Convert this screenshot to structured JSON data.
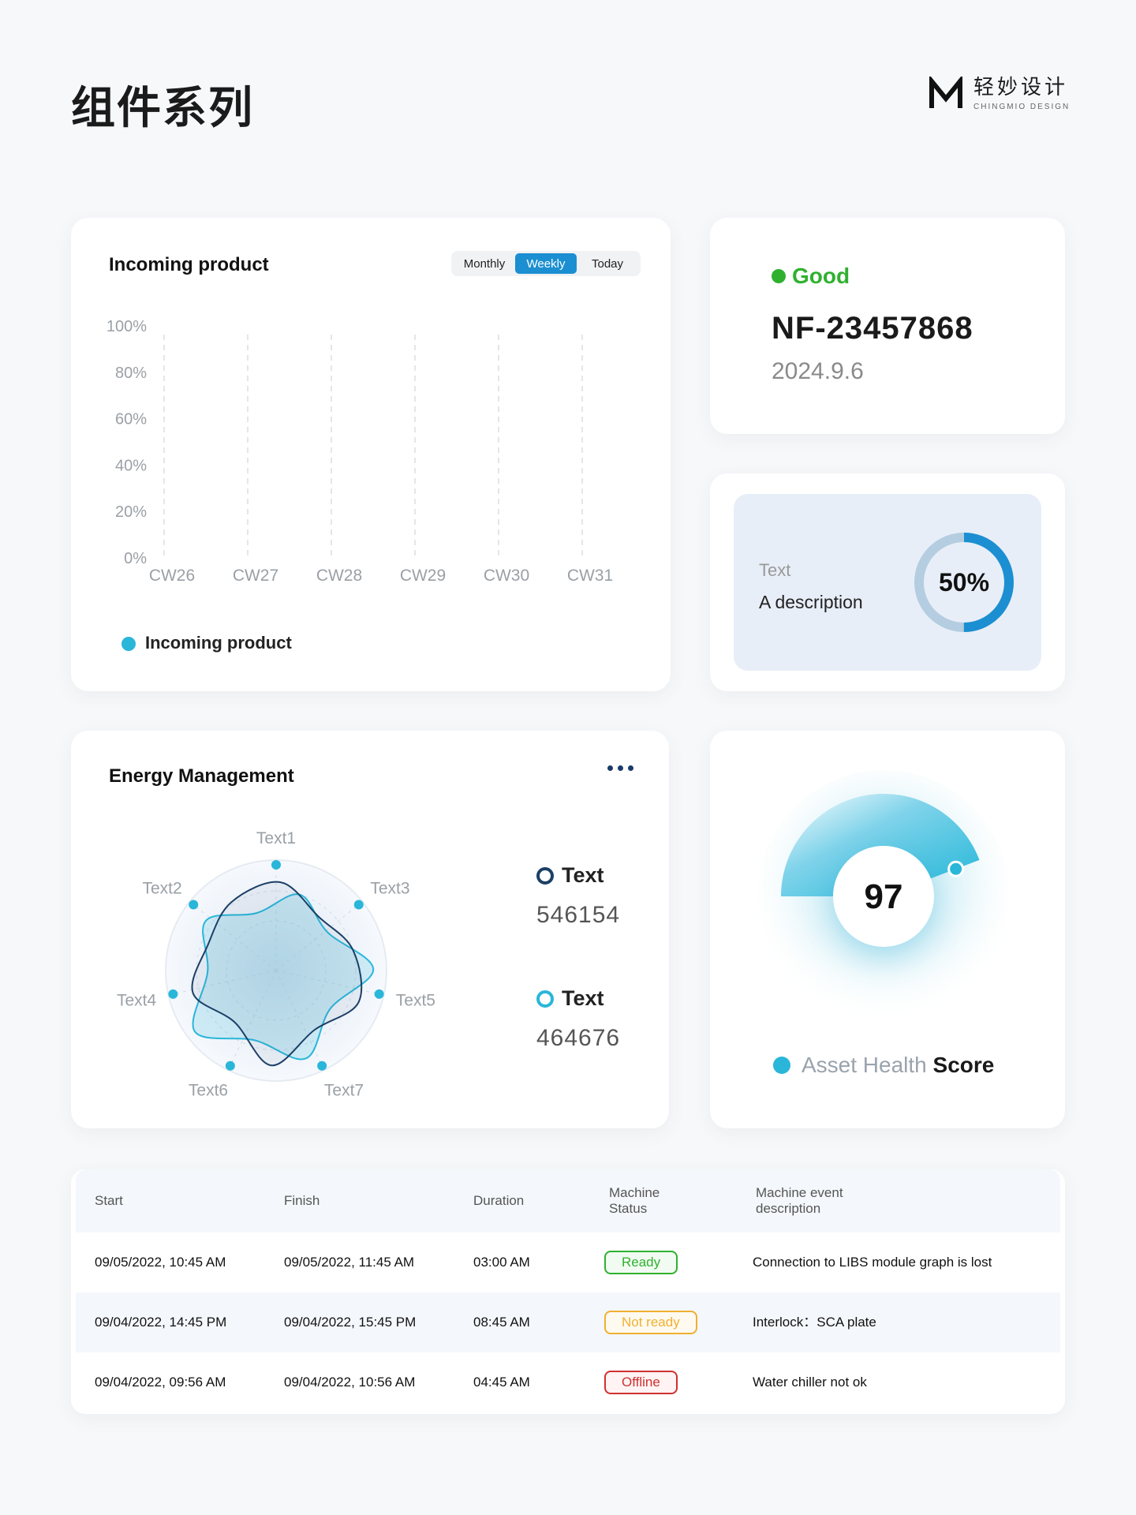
{
  "page": {
    "title": "组件系列"
  },
  "brand": {
    "name_cn": "轻妙设计",
    "name_en": "CHINGMIO DESIGN"
  },
  "incoming": {
    "title": "Incoming product",
    "segments": [
      "Monthly",
      "Weekly",
      "Today"
    ],
    "active_segment": "Weekly",
    "legend": "Incoming product",
    "chart_data": {
      "type": "bar",
      "categories": [
        "CW26",
        "CW27",
        "CW28",
        "CW29",
        "CW30",
        "CW31"
      ],
      "y_ticks": [
        "100%",
        "80%",
        "60%",
        "40%",
        "20%",
        "0%"
      ],
      "ylim": [
        0,
        100
      ],
      "grid": true,
      "series": [
        {
          "name": "Incoming product",
          "values": [
            0,
            0,
            0,
            0,
            0,
            0
          ]
        }
      ]
    }
  },
  "status": {
    "label": "Good",
    "code": "NF-23457868",
    "date": "2024.9.6",
    "color": "#2fb12f"
  },
  "percent_card": {
    "text": "Text",
    "description": "A description",
    "value_label": "50%",
    "value": 50
  },
  "energy": {
    "title": "Energy Management",
    "axes": [
      "Text1",
      "Text3",
      "Text5",
      "Text7",
      "Text6",
      "Text4",
      "Text2"
    ],
    "items": [
      {
        "label": "Text",
        "value": "546154"
      },
      {
        "label": "Text",
        "value": "464676"
      }
    ]
  },
  "health": {
    "score": "97",
    "score_value": 97,
    "legend_light": "Asset Health",
    "legend_dark": "Score"
  },
  "table": {
    "headers": [
      "Start",
      "Finish",
      "Duration",
      "Machine Status",
      "Machine event description"
    ],
    "rows": [
      {
        "start": "09/05/2022, 10:45 AM",
        "finish": "09/05/2022, 11:45 AM",
        "duration": "03:00 AM",
        "status": "Ready",
        "description": "Connection to LIBS module graph is lost"
      },
      {
        "start": "09/04/2022, 14:45 PM",
        "finish": "09/04/2022, 15:45 PM",
        "duration": "08:45 AM",
        "status": "Not ready",
        "description": "Interlock：SCA plate"
      },
      {
        "start": "09/04/2022, 09:56 AM",
        "finish": "09/04/2022, 10:56 AM",
        "duration": "04:45 AM",
        "status": "Offline",
        "description": "Water chiller not ok"
      }
    ]
  }
}
